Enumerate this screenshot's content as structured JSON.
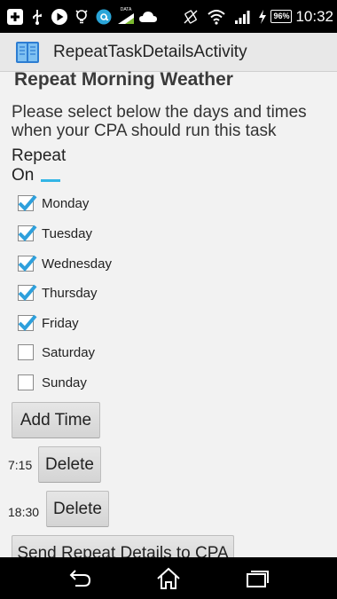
{
  "status_bar": {
    "battery": "96%",
    "time": "10:32",
    "icons": [
      "plus-icon",
      "usb-icon",
      "play-store-icon",
      "lightbulb-icon",
      "at-sign-icon",
      "data-icon",
      "cloud-icon",
      "no-vibrate-icon",
      "wifi-icon",
      "signal-icon",
      "charging-icon"
    ],
    "data_label": "DATA"
  },
  "action_bar": {
    "title": "RepeatTaskDetailsActivity",
    "icon": "app-book-icon"
  },
  "task": {
    "title": "Repeat Morning Weather",
    "instructions": "Please select below the days and times when your CPA should run this task"
  },
  "repeat_on_label": "Repeat On",
  "days": [
    {
      "label": "Monday",
      "checked": true
    },
    {
      "label": "Tuesday",
      "checked": true
    },
    {
      "label": "Wednesday",
      "checked": true
    },
    {
      "label": "Thursday",
      "checked": true
    },
    {
      "label": "Friday",
      "checked": true
    },
    {
      "label": "Saturday",
      "checked": false
    },
    {
      "label": "Sunday",
      "checked": false
    }
  ],
  "add_time_label": "Add Time",
  "times": [
    {
      "time": "7:15",
      "delete_label": "Delete"
    },
    {
      "time": "18:30",
      "delete_label": "Delete"
    }
  ],
  "send_label": "Send Repeat Details to CPA",
  "colors": {
    "accent": "#33b5e5",
    "checkbox": "#2ea0dc"
  },
  "nav_bar": {
    "icons": [
      "back-icon",
      "home-icon",
      "recents-icon"
    ]
  }
}
